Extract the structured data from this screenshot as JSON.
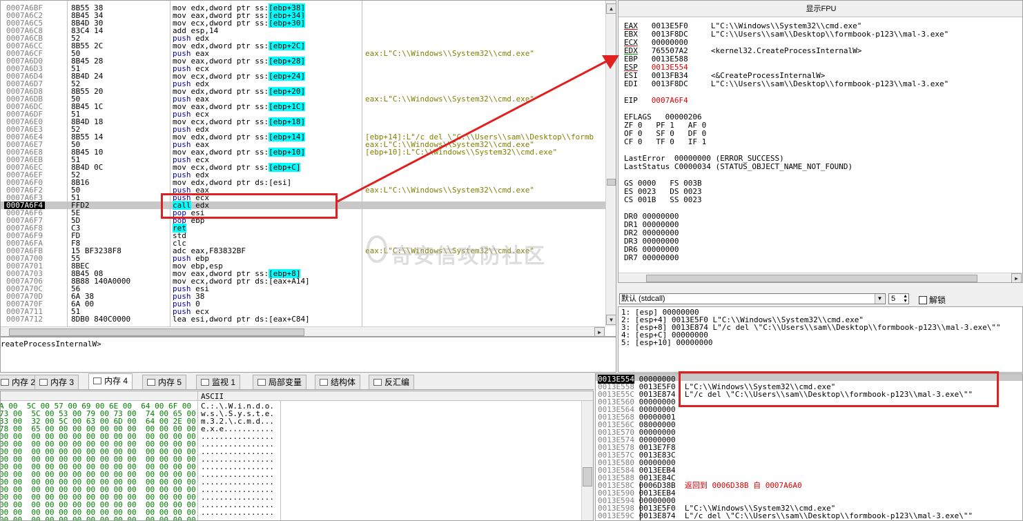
{
  "disasm": {
    "rows": [
      {
        "addr": "0007A6BF",
        "hex": "8B55 38",
        "op": "mov",
        "args": "edx,dword ptr ss:",
        "mem": "[ebp+38]",
        "cmt": ""
      },
      {
        "addr": "0007A6C2",
        "hex": "8B45 34",
        "op": "mov",
        "args": "eax,dword ptr ss:",
        "mem": "[ebp+34]",
        "cmt": ""
      },
      {
        "addr": "0007A6C5",
        "hex": "8B4D 30",
        "op": "mov",
        "args": "ecx,dword ptr ss:",
        "mem": "[ebp+30]",
        "cmt": ""
      },
      {
        "addr": "0007A6C8",
        "hex": "83C4 14",
        "op": "add",
        "args": "esp,14",
        "mem": "",
        "cmt": ""
      },
      {
        "addr": "0007A6CB",
        "hex": "52",
        "op": "push",
        "args": "edx",
        "mem": "",
        "cmt": ""
      },
      {
        "addr": "0007A6CC",
        "hex": "8B55 2C",
        "op": "mov",
        "args": "edx,dword ptr ss:",
        "mem": "[ebp+2C]",
        "cmt": ""
      },
      {
        "addr": "0007A6CF",
        "hex": "50",
        "op": "push",
        "args": "eax",
        "mem": "",
        "cmt": "eax:L\"C:\\\\Windows\\\\System32\\\\cmd.exe\""
      },
      {
        "addr": "0007A6D0",
        "hex": "8B45 28",
        "op": "mov",
        "args": "eax,dword ptr ss:",
        "mem": "[ebp+28]",
        "cmt": ""
      },
      {
        "addr": "0007A6D3",
        "hex": "51",
        "op": "push",
        "args": "ecx",
        "mem": "",
        "cmt": ""
      },
      {
        "addr": "0007A6D4",
        "hex": "8B4D 24",
        "op": "mov",
        "args": "ecx,dword ptr ss:",
        "mem": "[ebp+24]",
        "cmt": ""
      },
      {
        "addr": "0007A6D7",
        "hex": "52",
        "op": "push",
        "args": "edx",
        "mem": "",
        "cmt": ""
      },
      {
        "addr": "0007A6D8",
        "hex": "8B55 20",
        "op": "mov",
        "args": "edx,dword ptr ss:",
        "mem": "[ebp+20]",
        "cmt": ""
      },
      {
        "addr": "0007A6DB",
        "hex": "50",
        "op": "push",
        "args": "eax",
        "mem": "",
        "cmt": "eax:L\"C:\\\\Windows\\\\System32\\\\cmd.exe\""
      },
      {
        "addr": "0007A6DC",
        "hex": "8B45 1C",
        "op": "mov",
        "args": "eax,dword ptr ss:",
        "mem": "[ebp+1C]",
        "cmt": ""
      },
      {
        "addr": "0007A6DF",
        "hex": "51",
        "op": "push",
        "args": "ecx",
        "mem": "",
        "cmt": ""
      },
      {
        "addr": "0007A6E0",
        "hex": "8B4D 18",
        "op": "mov",
        "args": "ecx,dword ptr ss:",
        "mem": "[ebp+18]",
        "cmt": ""
      },
      {
        "addr": "0007A6E3",
        "hex": "52",
        "op": "push",
        "args": "edx",
        "mem": "",
        "cmt": ""
      },
      {
        "addr": "0007A6E4",
        "hex": "8B55 14",
        "op": "mov",
        "args": "edx,dword ptr ss:",
        "mem": "[ebp+14]",
        "cmt": "[ebp+14]:L\"/c del \\\"C:\\\\Users\\\\sam\\\\Desktop\\\\formb"
      },
      {
        "addr": "0007A6E7",
        "hex": "50",
        "op": "push",
        "args": "eax",
        "mem": "",
        "cmt": "eax:L\"C:\\\\Windows\\\\System32\\\\cmd.exe\""
      },
      {
        "addr": "0007A6E8",
        "hex": "8B45 10",
        "op": "mov",
        "args": "eax,dword ptr ss:",
        "mem": "[ebp+10]",
        "cmt": "[ebp+10]:L\"C:\\\\Windows\\\\System32\\\\cmd.exe\""
      },
      {
        "addr": "0007A6EB",
        "hex": "51",
        "op": "push",
        "args": "ecx",
        "mem": "",
        "cmt": ""
      },
      {
        "addr": "0007A6EC",
        "hex": "8B4D 0C",
        "op": "mov",
        "args": "ecx,dword ptr ss:",
        "mem": "[ebp+C]",
        "cmt": ""
      },
      {
        "addr": "0007A6EF",
        "hex": "52",
        "op": "push",
        "args": "edx",
        "mem": "",
        "cmt": ""
      },
      {
        "addr": "0007A6F0",
        "hex": "8B16",
        "op": "mov",
        "args": "edx,dword ptr ds:[esi]",
        "mem": "",
        "cmt": ""
      },
      {
        "addr": "0007A6F2",
        "hex": "50",
        "op": "push",
        "args": "eax",
        "mem": "",
        "cmt": "eax:L\"C:\\\\Windows\\\\System32\\\\cmd.exe\""
      },
      {
        "addr": "0007A6F3",
        "hex": "51",
        "op": "push",
        "args": "ecx",
        "mem": "",
        "cmt": ""
      },
      {
        "addr": "0007A6F4",
        "hex": "FFD2",
        "op": "call",
        "args": "edx",
        "mem": "",
        "cmt": "",
        "eip": true
      },
      {
        "addr": "0007A6F6",
        "hex": "5E",
        "op": "pop",
        "args": "esi",
        "mem": "",
        "cmt": ""
      },
      {
        "addr": "0007A6F7",
        "hex": "5D",
        "op": "pop",
        "args": "ebp",
        "mem": "",
        "cmt": ""
      },
      {
        "addr": "0007A6F8",
        "hex": "C3",
        "op": "ret",
        "args": "",
        "mem": "",
        "cmt": ""
      },
      {
        "addr": "0007A6F9",
        "hex": "FD",
        "op": "std",
        "args": "",
        "mem": "",
        "cmt": ""
      },
      {
        "addr": "0007A6FA",
        "hex": "F8",
        "op": "clc",
        "args": "",
        "mem": "",
        "cmt": ""
      },
      {
        "addr": "0007A6FB",
        "hex": "15 BF3238F8",
        "op": "adc",
        "args": "eax,F83832BF",
        "mem": "",
        "cmt": "eax:L\"C:\\\\Windows\\\\System32\\\\cmd.exe\""
      },
      {
        "addr": "0007A700",
        "hex": "55",
        "op": "push",
        "args": "ebp",
        "mem": "",
        "cmt": ""
      },
      {
        "addr": "0007A701",
        "hex": "8BEC",
        "op": "mov",
        "args": "ebp,esp",
        "mem": "",
        "cmt": ""
      },
      {
        "addr": "0007A703",
        "hex": "8B45 08",
        "op": "mov",
        "args": "eax,dword ptr ss:",
        "mem": "[ebp+8]",
        "cmt": ""
      },
      {
        "addr": "0007A706",
        "hex": "8B88 140A0000",
        "op": "mov",
        "args": "ecx,dword ptr ds:[eax+A14]",
        "mem": "",
        "cmt": ""
      },
      {
        "addr": "0007A70C",
        "hex": "56",
        "op": "push",
        "args": "esi",
        "mem": "",
        "cmt": ""
      },
      {
        "addr": "0007A70D",
        "hex": "6A 38",
        "op": "push",
        "args": "38",
        "mem": "",
        "cmt": ""
      },
      {
        "addr": "0007A70F",
        "hex": "6A 00",
        "op": "push",
        "args": "0",
        "mem": "",
        "cmt": ""
      },
      {
        "addr": "0007A711",
        "hex": "51",
        "op": "push",
        "args": "ecx",
        "mem": "",
        "cmt": ""
      },
      {
        "addr": "0007A712",
        "hex": "8DB0 840C0000",
        "op": "lea",
        "args": "esi,dword ptr ds:[eax+C84]",
        "mem": "",
        "cmt": ""
      }
    ],
    "info_line": "reateProcessInternalW>"
  },
  "regs": {
    "title": "显示FPU",
    "gp": [
      {
        "name": "EAX",
        "val": "0013E5F0",
        "cmt": "L\"C:\\\\Windows\\\\System32\\\\cmd.exe\"",
        "style": "ul-red"
      },
      {
        "name": "EBX",
        "val": "0013F8DC",
        "cmt": "L\"C:\\\\Users\\\\sam\\\\Desktop\\\\formbook-p123\\\\mal-3.exe\"",
        "style": ""
      },
      {
        "name": "ECX",
        "val": "00000000",
        "cmt": "",
        "style": "ul-red"
      },
      {
        "name": "EDX",
        "val": "765507A2",
        "cmt": "<kernel32.CreateProcessInternalW>",
        "style": "ul-green"
      },
      {
        "name": "EBP",
        "val": "0013E588",
        "cmt": "",
        "style": ""
      },
      {
        "name": "ESP",
        "val": "0013E554",
        "cmt": "",
        "style": "ul-red",
        "valred": true
      },
      {
        "name": "ESI",
        "val": "0013FB34",
        "cmt": "<&CreateProcessInternalW>",
        "style": ""
      },
      {
        "name": "EDI",
        "val": "0013F8DC",
        "cmt": "L\"C:\\\\Users\\\\sam\\\\Desktop\\\\formbook-p123\\\\mal-3.exe\"",
        "style": ""
      }
    ],
    "eip": "EIP   0007A6F4",
    "eflags": "EFLAGS   00000206",
    "flags": [
      "ZF 0   PF 1   AF 0",
      "OF 0   SF 0   DF 0",
      "CF 0   TF 0   IF 1"
    ],
    "last_error": "LastError  00000000 (ERROR_SUCCESS)",
    "last_status": "LastStatus C0000034 (STATUS_OBJECT_NAME_NOT_FOUND)",
    "segs": [
      "GS 0000   FS 003B",
      "ES 0023   DS 0023",
      "CS 001B   SS 0023"
    ],
    "drs": [
      "DR0 00000000",
      "DR1 00000000",
      "DR2 00000000",
      "DR3 00000000",
      "DR6 00000000",
      "DR7 00000000"
    ]
  },
  "callconv": {
    "value": "默认 (stdcall)",
    "count": "5",
    "unlock": "解锁"
  },
  "args": [
    "1: [esp] 00000000",
    "2: [esp+4] 0013E5F0 L\"C:\\\\Windows\\\\System32\\\\cmd.exe\"",
    "3: [esp+8] 0013E874 L\"/c del \\\"C:\\\\Users\\\\sam\\\\Desktop\\\\formbook-p123\\\\mal-3.exe\\\"\"",
    "4: [esp+C] 00000000",
    "5: [esp+10] 00000000"
  ],
  "tabs": [
    {
      "label": "内存 2",
      "active": false
    },
    {
      "label": "内存 3",
      "active": false
    },
    {
      "label": "内存 4",
      "active": true
    },
    {
      "label": "内存 5",
      "active": false
    },
    {
      "label": "监视 1",
      "active": false
    },
    {
      "label": "局部变量",
      "active": false
    },
    {
      "label": "结构体",
      "active": false
    },
    {
      "label": "反汇编",
      "active": false
    }
  ],
  "dump": {
    "ascii_header": "ASCII",
    "rows": [
      {
        "hex": "A 00  5C 00 57 00 69 00 6E 00  64 00 6F 00",
        "ascii": "C.:.\\.W.i.n.d.o."
      },
      {
        "hex": "73 00  5C 00 53 00 79 00 73 00  74 00 65 00",
        "ascii": "w.s.\\.S.y.s.t.e."
      },
      {
        "hex": "33 00  32 00 5C 00 63 00 6D 00  64 00 2E 00",
        "ascii": "m.3.2.\\.c.m.d..."
      },
      {
        "hex": "78 00  65 00 00 00 00 00 00 00  00 00 00 00",
        "ascii": "e.x.e..........."
      },
      {
        "hex": "00 00  00 00 00 00 00 00 00 00  00 00 00 00",
        "ascii": "................"
      },
      {
        "hex": "00 00  00 00 00 00 00 00 00 00  00 00 00 00",
        "ascii": "................"
      },
      {
        "hex": "00 00  00 00 00 00 00 00 00 00  00 00 00 00",
        "ascii": "................"
      },
      {
        "hex": "00 00  00 00 00 00 00 00 00 00  00 00 00 00",
        "ascii": "................"
      },
      {
        "hex": "00 00  00 00 00 00 00 00 00 00  00 00 00 00",
        "ascii": "................"
      },
      {
        "hex": "00 00  00 00 00 00 00 00 00 00  00 00 00 00",
        "ascii": "................"
      },
      {
        "hex": "00 00  00 00 00 00 00 00 00 00  00 00 00 00",
        "ascii": "................"
      },
      {
        "hex": "00 00  00 00 00 00 00 00 00 00  00 00 00 00",
        "ascii": "................"
      },
      {
        "hex": "00 00  00 00 00 00 00 00 00 00  00 00 00 00",
        "ascii": "................"
      },
      {
        "hex": "00 00  00 00 00 00 00 00 00 00  00 00 00 00",
        "ascii": "................"
      },
      {
        "hex": "00 00  00 00 00 00 00 00 00 00  00 00 00 00",
        "ascii": "................"
      },
      {
        "hex": "00 00  00 00 00 00 00 00 00 00  00 00 00 00",
        "ascii": "................"
      }
    ]
  },
  "stack": {
    "rows": [
      {
        "addr": "0013E554",
        "val": "00000000",
        "cmt": ""
      },
      {
        "addr": "0013E558",
        "val": "0013E5F0",
        "cmt": "L\"C:\\\\Windows\\\\System32\\\\cmd.exe\""
      },
      {
        "addr": "0013E55C",
        "val": "0013E874",
        "cmt": "L\"/c del \\\"C:\\\\Users\\\\sam\\\\Desktop\\\\formbook-p123\\\\mal-3.exe\\\"\""
      },
      {
        "addr": "0013E560",
        "val": "00000000",
        "cmt": ""
      },
      {
        "addr": "0013E564",
        "val": "00000000",
        "cmt": ""
      },
      {
        "addr": "0013E568",
        "val": "00000001",
        "cmt": ""
      },
      {
        "addr": "0013E56C",
        "val": "08000000",
        "cmt": ""
      },
      {
        "addr": "0013E570",
        "val": "00000000",
        "cmt": ""
      },
      {
        "addr": "0013E574",
        "val": "00000000",
        "cmt": ""
      },
      {
        "addr": "0013E578",
        "val": "0013E7F8",
        "cmt": ""
      },
      {
        "addr": "0013E57C",
        "val": "0013E83C",
        "cmt": ""
      },
      {
        "addr": "0013E580",
        "val": "00000000",
        "cmt": ""
      },
      {
        "addr": "0013E584",
        "val": "0013EEB4",
        "cmt": ""
      },
      {
        "addr": "0013E588",
        "val": "0013E84C",
        "cmt": ""
      },
      {
        "addr": "0013E58C",
        "val": "0006D38B",
        "cmt": "返回到 0006D38B 自 0007A6A0",
        "ret": true
      },
      {
        "addr": "0013E590",
        "val": "0013EEB4",
        "cmt": ""
      },
      {
        "addr": "0013E594",
        "val": "00000000",
        "cmt": ""
      },
      {
        "addr": "0013E598",
        "val": "0013E5F0",
        "cmt": "L\"C:\\\\Windows\\\\System32\\\\cmd.exe\""
      },
      {
        "addr": "0013E59C",
        "val": "0013E874",
        "cmt": "L\"/c del \\\"C:\\\\Users\\\\sam\\\\Desktop\\\\formbook-p123\\\\mal-3.exe\\\"\""
      }
    ]
  },
  "watermark": "奇安信攻防社区"
}
